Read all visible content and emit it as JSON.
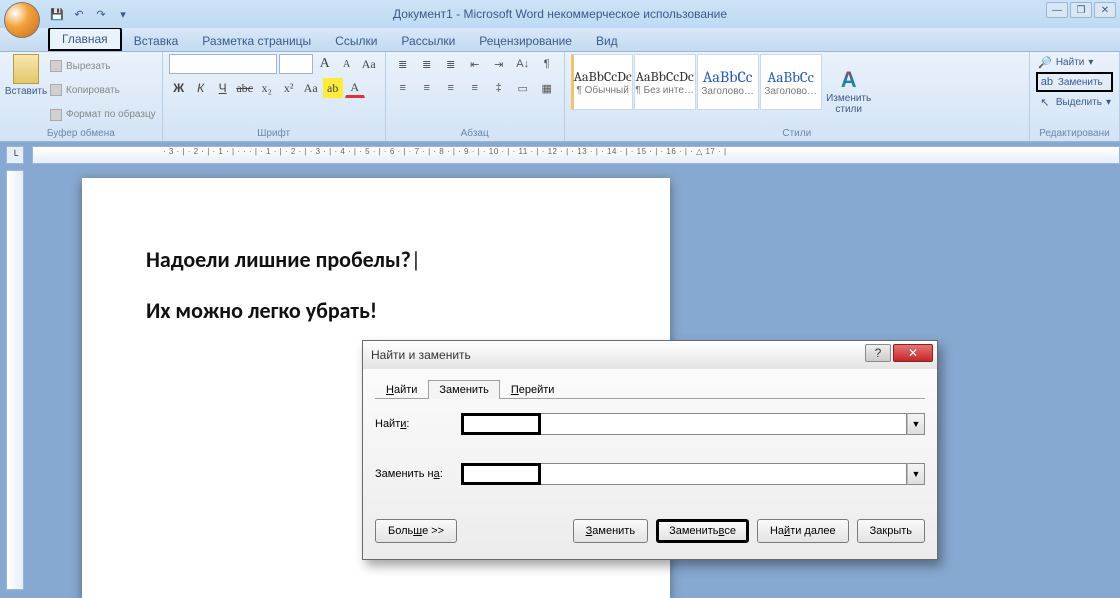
{
  "title": "Документ1 - Microsoft Word некоммерческое использование",
  "tabs": {
    "home": "Главная",
    "insert": "Вставка",
    "layout": "Разметка страницы",
    "references": "Ссылки",
    "mailings": "Рассылки",
    "review": "Рецензирование",
    "view": "Вид"
  },
  "ribbon": {
    "clipboard": {
      "paste": "Вставить",
      "cut": "Вырезать",
      "copy": "Копировать",
      "format_painter": "Формат по образцу",
      "group_label": "Буфер обмена"
    },
    "font": {
      "group_label": "Шрифт",
      "font_size_grow": "A",
      "font_size_shrink": "A"
    },
    "paragraph": {
      "group_label": "Абзац"
    },
    "styles": {
      "group_label": "Стили",
      "items": [
        {
          "preview": "AaBbCcDc",
          "name": "¶ Обычный"
        },
        {
          "preview": "AaBbCcDc",
          "name": "¶ Без инте…"
        },
        {
          "preview": "AaBbCc",
          "name": "Заголово…"
        },
        {
          "preview": "AaBbCc",
          "name": "Заголово…"
        }
      ],
      "change": "Изменить стили"
    },
    "editing": {
      "group_label": "Редактировани",
      "find": "Найти",
      "replace": "Заменить",
      "select": "Выделить"
    }
  },
  "ruler": "· 3 · | · 2 · | · 1 · | · · · | · 1 · | · 2 · | · 3 · | · 4 · | · 5 · | · 6 · | · 7 · | · 8 · | · 9 · | · 10 · | · 11 · | · 12 · | · 13 · | · 14 · | · 15 · | · 16 · | · △ 17 · |",
  "document": {
    "line1": "Надоели лишние  пробелы?",
    "line2": "Их можно легко    убрать!"
  },
  "dialog": {
    "title": "Найти и заменить",
    "tabs": {
      "find": "Найти",
      "replace": "Заменить",
      "goto": "Перейти"
    },
    "labels": {
      "find": "Найти:",
      "replace": "Заменить на:"
    },
    "buttons": {
      "more": "Больше >>",
      "replace": "Заменить",
      "replace_all": "Заменить все",
      "find_next": "Найти далее",
      "close": "Закрыть"
    }
  }
}
